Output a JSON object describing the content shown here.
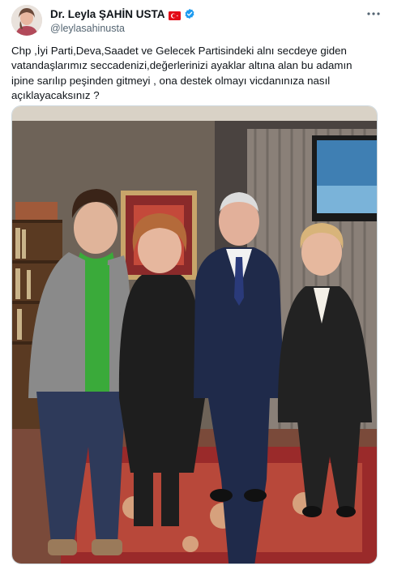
{
  "author": {
    "display_name": "Dr. Leyla ŞAHİN USTA",
    "handle": "@leylasahinusta",
    "avatar_icon": "profile-avatar",
    "flag_icon": "turkey-flag-icon",
    "verified_icon": "verified-badge-icon",
    "verified_color": "#1d9bf0"
  },
  "tweet": {
    "text": "Chp ,İyi Parti,Deva,Saadet ve Gelecek Partisindeki alnı secdeye giden vatandaşlarımız seccadenizi,değerlerinizi ayaklar altına alan bu adamın ipine sarılıp peşinden gitmeyi , ona destek olmayı vicdanınıza nasıl açıklayacaksınız ?"
  },
  "actions": {
    "more_icon": "more-options-icon"
  },
  "colors": {
    "text_primary": "#0f1419",
    "text_secondary": "#536471",
    "border": "#cfd9de"
  }
}
